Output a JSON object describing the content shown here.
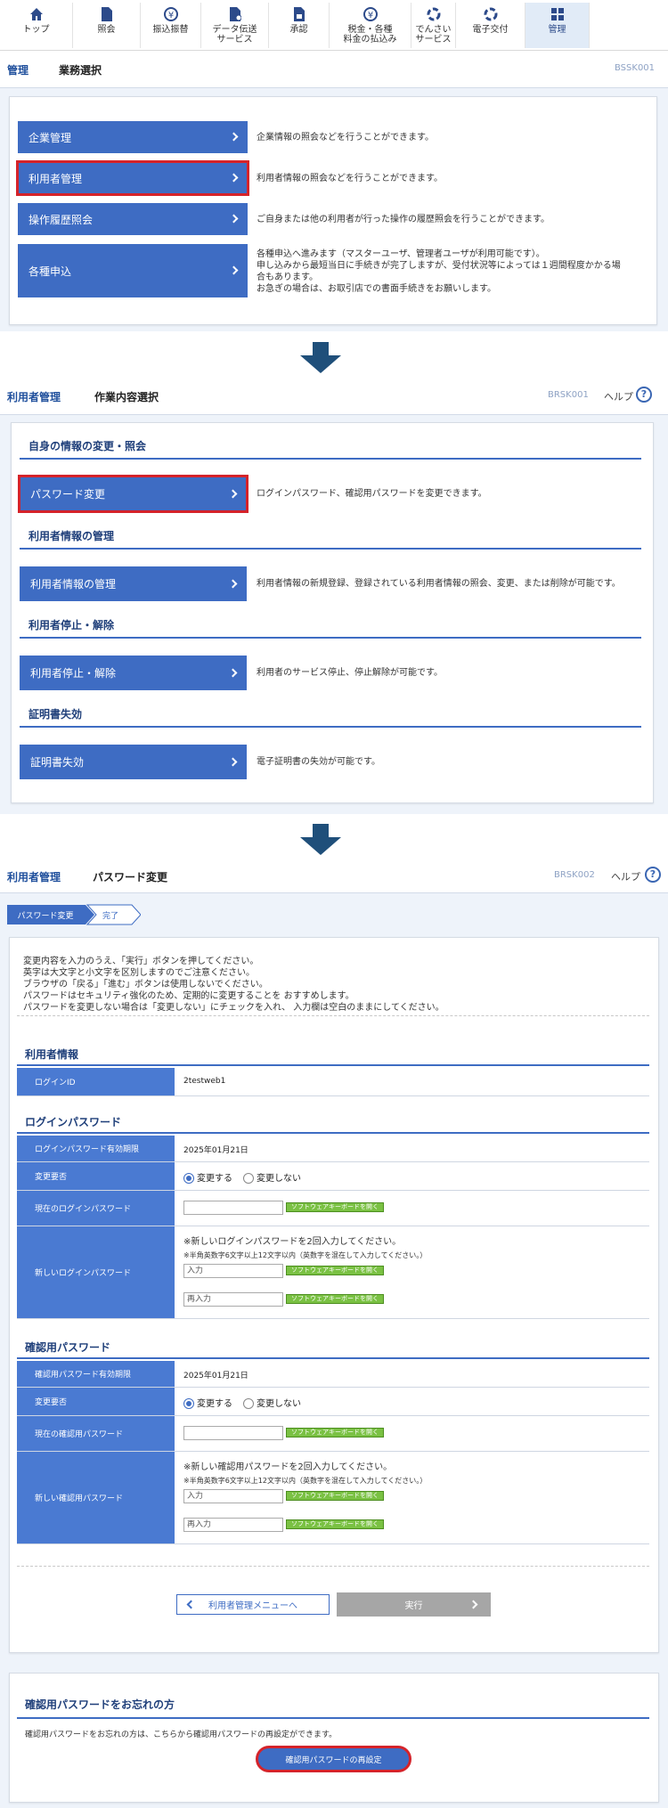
{
  "nav": {
    "items": [
      {
        "label": "トップ",
        "icon": "home-icon"
      },
      {
        "label": "照会",
        "icon": "document-icon"
      },
      {
        "label": "振込振替",
        "icon": "yen-arrow-icon"
      },
      {
        "label": "データ伝送\nサービス",
        "icon": "data-transfer-icon"
      },
      {
        "label": "承認",
        "icon": "approval-icon"
      },
      {
        "label": "税金・各種\n料金の払込み",
        "icon": "yen-circle-icon"
      },
      {
        "label": "でんさい\nサービス",
        "icon": "densai-icon"
      },
      {
        "label": "電子交付",
        "icon": "e-delivery-icon"
      },
      {
        "label": "管理",
        "icon": "management-icon"
      }
    ],
    "active_color": "#e1ebf7"
  },
  "screen1": {
    "category": "管理",
    "title": "業務選択",
    "code": "BSSK001",
    "items": [
      {
        "label": "企業管理",
        "desc": "企業情報の照会などを行うことができます。"
      },
      {
        "label": "利用者管理",
        "desc": "利用者情報の照会などを行うことができます。"
      },
      {
        "label": "操作履歴照会",
        "desc": "ご自身または他の利用者が行った操作の履歴照会を行うことができます。"
      },
      {
        "label": "各種申込",
        "desc1": "各種申込へ進みます（マスターユーザ、管理者ユーザが利用可能です）。",
        "desc2": "申し込みから最短当日に手続きが完了しますが、受付状況等によっては１週間程度かかる場",
        "desc3": "合もあります。",
        "desc4": "お急ぎの場合は、お取引店での書面手続きをお願いします。"
      }
    ]
  },
  "screen2": {
    "category": "利用者管理",
    "title": "作業内容選択",
    "code": "BRSK001",
    "help": "ヘルプ",
    "sections": [
      {
        "heading": "自身の情報の変更・照会",
        "button": "パスワード変更",
        "desc": "ログインパスワード、確認用パスワードを変更できます。"
      },
      {
        "heading": "利用者情報の管理",
        "button": "利用者情報の管理",
        "desc": "利用者情報の新規登録、登録されている利用者情報の照会、変更、または削除が可能です。"
      },
      {
        "heading": "利用者停止・解除",
        "button": "利用者停止・解除",
        "desc": "利用者のサービス停止、停止解除が可能です。"
      },
      {
        "heading": "証明書失効",
        "button": "証明書失効",
        "desc": "電子証明書の失効が可能です。"
      }
    ]
  },
  "screen3": {
    "category": "利用者管理",
    "title": "パスワード変更",
    "code": "BRSK002",
    "help": "ヘルプ",
    "steps": [
      "パスワード変更",
      "完了"
    ],
    "instructions": [
      "変更内容を入力のうえ、「実行」ボタンを押してください。",
      "英字は大文字と小文字を区別しますのでご注意ください。",
      "ブラウザの「戻る」「進む」ボタンは使用しないでください。",
      "パスワードはセキュリティ強化のため、定期的に変更することを おすすめします。",
      "パスワードを変更しない場合は「変更しない」にチェックを入れ、 入力欄は空白のままにしてください。"
    ],
    "user_info": {
      "heading": "利用者情報",
      "login_id_label": "ログインID",
      "login_id": "2testweb1"
    },
    "login_pw": {
      "heading": "ログインパスワード",
      "expiry_label": "ログインパスワード有効期限",
      "expiry": "2025年01月21日",
      "change_label": "変更要否",
      "change_yes": "変更する",
      "change_no": "変更しない",
      "current_label": "現在のログインパスワード",
      "new_label": "新しいログインパスワード",
      "new_note1": "※新しいログインパスワードを2回入力してください。",
      "new_note2": "※半角英数字6文字以上12文字以内（英数字を混在して入力してください。）",
      "input_ph": "入力",
      "reinput_ph": "再入力"
    },
    "confirm_pw": {
      "heading": "確認用パスワード",
      "expiry_label": "確認用パスワード有効期限",
      "expiry": "2025年01月21日",
      "change_label": "変更要否",
      "change_yes": "変更する",
      "change_no": "変更しない",
      "current_label": "現在の確認用パスワード",
      "new_label": "新しい確認用パスワード",
      "new_note1": "※新しい確認用パスワードを2回入力してください。",
      "new_note2": "※半角英数字6文字以上12文字以内（英数字を混在して入力してください。）",
      "input_ph": "入力",
      "reinput_ph": "再入力"
    },
    "software_keyboard": "ソフトウェアキーボードを開く",
    "back_button": "利用者管理メニューへ",
    "exec_button": "実行",
    "forgot": {
      "heading": "確認用パスワードをお忘れの方",
      "text": "確認用パスワードをお忘れの方は、こちらから確認用パスワードの再設定ができます。",
      "button": "確認用パスワードの再設定"
    }
  },
  "colors": {
    "primary": "#3e6cc3",
    "highlight": "#d5232a",
    "label_bg": "#4a7ad2",
    "keyboard": "#7ac143"
  }
}
